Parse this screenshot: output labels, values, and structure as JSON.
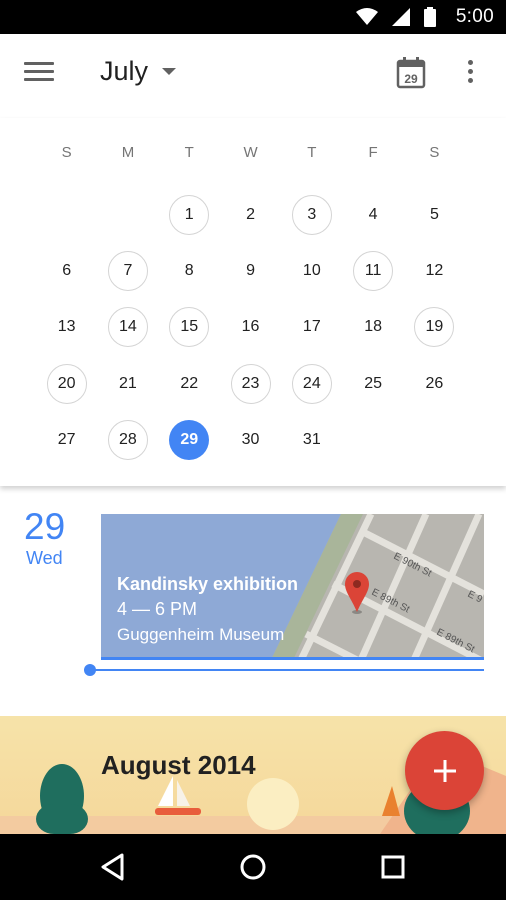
{
  "status_bar": {
    "time": "5:00",
    "icons": [
      "wifi-icon",
      "signal-icon",
      "battery-icon"
    ]
  },
  "header": {
    "month": "July",
    "today_icon_label": "29"
  },
  "calendar": {
    "weekdays": [
      "S",
      "M",
      "T",
      "W",
      "T",
      "F",
      "S"
    ],
    "weeks": [
      [
        "",
        "",
        "1",
        "2",
        "3",
        "4",
        "5"
      ],
      [
        "6",
        "7",
        "8",
        "9",
        "10",
        "11",
        "12"
      ],
      [
        "13",
        "14",
        "15",
        "16",
        "17",
        "18",
        "19"
      ],
      [
        "20",
        "21",
        "22",
        "23",
        "24",
        "25",
        "26"
      ],
      [
        "27",
        "28",
        "29",
        "30",
        "31",
        "",
        ""
      ]
    ],
    "event_days": [
      "1",
      "3",
      "7",
      "11",
      "14",
      "15",
      "19",
      "20",
      "23",
      "24",
      "28"
    ],
    "selected_day": "29"
  },
  "agenda": {
    "date_number": "29",
    "date_weekday": "Wed",
    "event": {
      "title": "Kandinsky exhibition",
      "time": "4 — 6 PM",
      "location": "Guggenheim Museum",
      "map_streets": [
        "E 90th St",
        "E 89th St",
        "E 89th St",
        "E 9"
      ]
    }
  },
  "month_banner": {
    "title": "August 2014"
  },
  "colors": {
    "accent": "#4285f4",
    "fab": "#db4437",
    "map_water": "#8ea9d6",
    "map_land": "#b8b6b0"
  },
  "fab_icon": "plus-icon",
  "nav_bar": {
    "icons": [
      "back-icon",
      "home-icon",
      "recents-icon"
    ]
  }
}
